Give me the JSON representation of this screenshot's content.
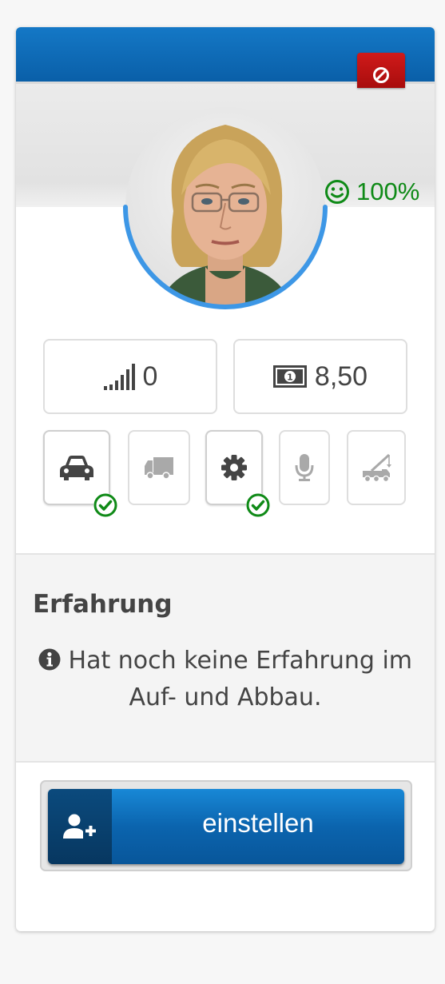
{
  "worker": {
    "satisfaction": "100%",
    "level": "0",
    "wage": "8,50"
  },
  "skills": [
    {
      "icon": "car-icon",
      "active": true
    },
    {
      "icon": "truck-icon",
      "active": false
    },
    {
      "icon": "gear-icon",
      "active": true
    },
    {
      "icon": "microphone-icon",
      "active": false
    },
    {
      "icon": "crane-truck-icon",
      "active": false
    }
  ],
  "experience": {
    "title": "Erfahrung",
    "text": "Hat noch keine Erfahrung im Auf- und Abbau."
  },
  "actions": {
    "hire_label": "einstellen"
  },
  "colors": {
    "header": "#0a66b0",
    "close": "#c01414",
    "ring": "#3d97e6",
    "success": "#0f8a17"
  }
}
